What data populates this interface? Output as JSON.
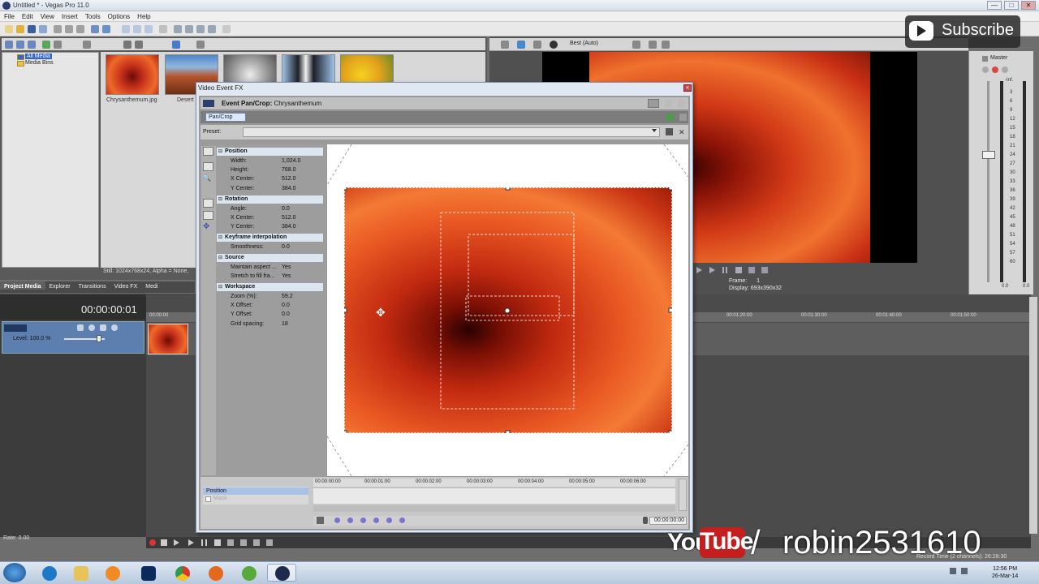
{
  "window": {
    "title": "Untitled * - Vegas Pro 11.0",
    "minimize": "—",
    "maximize": "□",
    "close": "✕"
  },
  "menu": [
    "File",
    "Edit",
    "View",
    "Insert",
    "Tools",
    "Options",
    "Help"
  ],
  "explorer": {
    "tree": [
      "All Media",
      "Media Bins"
    ],
    "thumbnails": [
      {
        "label": "Chrysanthemum.jpg",
        "color": "#c8321b"
      },
      {
        "label": "Desert",
        "color": "#a0522d"
      },
      {
        "label": "",
        "color": "#b9b9b9"
      },
      {
        "label": "",
        "color": "#2f3f59"
      },
      {
        "label": "",
        "color": "#e2c21c"
      }
    ],
    "status": "Still: 1024x768x24, Alpha = None,",
    "tabs": [
      "Project Media",
      "Explorer",
      "Transitions",
      "Video FX",
      "Medi"
    ]
  },
  "timeline": {
    "timecode": "00:00:00:01",
    "start_label": "00:00:00",
    "level": "Level: 100.0 %",
    "rate": "Rate: 0.00",
    "ruler": [
      "00:01:20:00",
      "00:01:30:00",
      "00:01:40:00",
      "00:01:50:00"
    ],
    "record_time": "Record Time (2 channels): 26:28:30"
  },
  "preview": {
    "quality": "Best (Auto)",
    "frame_label": "Frame:",
    "frame_value": "1",
    "display_label": "Display:",
    "display_value": "693x390x32"
  },
  "mixer": {
    "title": "Master",
    "ticks": [
      "-Inf.",
      "3",
      "6",
      "9",
      "12",
      "15",
      "18",
      "21",
      "24",
      "27",
      "30",
      "33",
      "36",
      "39",
      "42",
      "45",
      "48",
      "51",
      "54",
      "57",
      "60"
    ],
    "left_readout": "0.0",
    "right_readout": "0.0"
  },
  "subscribe": {
    "label": "Subscribe"
  },
  "fx": {
    "title": "Video Event FX",
    "plugin_label": "Event Pan/Crop:",
    "plugin_name": "Chrysanthemum",
    "chain_button": "Pan/Crop",
    "preset_label": "Preset:",
    "groups": {
      "position": {
        "title": "Position",
        "rows": [
          [
            "Width:",
            "1,024.0"
          ],
          [
            "Height:",
            "768.0"
          ],
          [
            "X Center:",
            "512.0"
          ],
          [
            "Y Center:",
            "384.0"
          ]
        ]
      },
      "rotation": {
        "title": "Rotation",
        "rows": [
          [
            "Angle:",
            "0.0"
          ],
          [
            "X Center:",
            "512.0"
          ],
          [
            "Y Center:",
            "384.0"
          ]
        ]
      },
      "keyframe": {
        "title": "Keyframe interpolation",
        "rows": [
          [
            "Smoothness:",
            "0.0"
          ]
        ]
      },
      "source": {
        "title": "Source",
        "rows": [
          [
            "Maintain aspect ...",
            "Yes"
          ],
          [
            "Stretch to fill fra...",
            "Yes"
          ]
        ]
      },
      "workspace": {
        "title": "Workspace",
        "rows": [
          [
            "Zoom (%):",
            "59.2"
          ],
          [
            "X Offset:",
            "0.0"
          ],
          [
            "Y Offset:",
            "0.0"
          ],
          [
            "Grid spacing:",
            "18"
          ]
        ]
      }
    },
    "keyframes": {
      "track_label": "Position",
      "mask_label": "Mask",
      "ruler": [
        "00:00:00:00",
        "00:00:01:00",
        "00:00:02:00",
        "00:00:03:00",
        "00:00:04:00",
        "00:00:05:00",
        "00:00:06:00"
      ],
      "time": "00:00:00:00"
    }
  },
  "overlay": {
    "you": "You",
    "tube": "Tube",
    "slash": "/",
    "channel": "robin2531610"
  },
  "taskbar": {
    "apps": [
      {
        "name": "internet-explorer",
        "color": "#1e78c8"
      },
      {
        "name": "file-explorer",
        "color": "#e8c35a"
      },
      {
        "name": "media-player",
        "color": "#f08a24"
      },
      {
        "name": "photoshop",
        "color": "#0a2a5e"
      },
      {
        "name": "chrome",
        "color": "#d83a2a"
      },
      {
        "name": "firefox",
        "color": "#e36a1c"
      },
      {
        "name": "utorrent",
        "color": "#56a93a"
      },
      {
        "name": "vegas",
        "color": "#1c2b4d"
      }
    ],
    "time": "12:56 PM",
    "date": "26-Mar-14"
  }
}
